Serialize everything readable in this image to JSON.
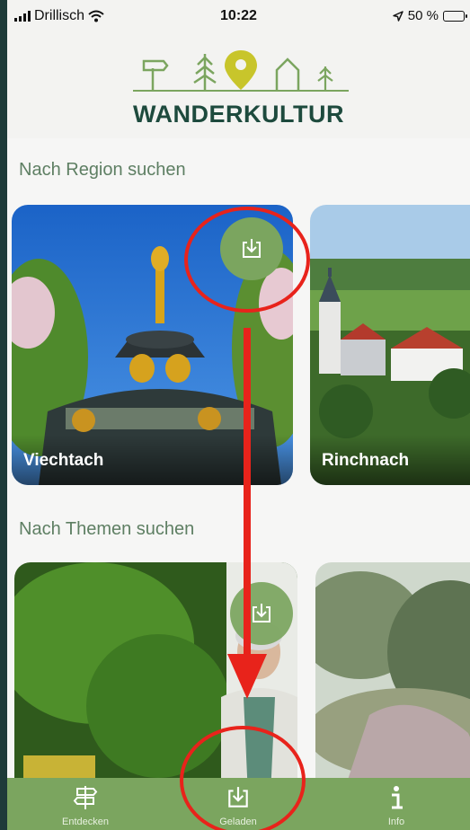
{
  "status": {
    "carrier": "Drillisch",
    "time": "10:22",
    "battery": "50 %",
    "battery_level": 0.5,
    "icons": [
      "signal-bars-icon",
      "wifi-icon",
      "location-arrow-icon",
      "battery-icon"
    ]
  },
  "header": {
    "logo_text": "WANDERKULTUR",
    "logo_icons": [
      "signpost-icon",
      "tree-icon",
      "location-pin-icon",
      "house-icon",
      "tree-icon"
    ]
  },
  "sections": {
    "region": {
      "title": "Nach Region suchen",
      "cards": [
        {
          "label": "Viechtach"
        },
        {
          "label": "Rinchnach"
        }
      ]
    },
    "themes": {
      "title": "Nach Themen suchen"
    }
  },
  "tabbar": {
    "items": [
      {
        "label": "Entdecken",
        "icon": "signpost-icon"
      },
      {
        "label": "Geladen",
        "icon": "download-icon"
      },
      {
        "label": "Info",
        "icon": "info-icon"
      }
    ]
  },
  "colors": {
    "brand_green": "#7ba55f",
    "dark_green": "#1d4a3d",
    "annotation_red": "#e8231b",
    "pin_yellow": "#c8c52b"
  }
}
